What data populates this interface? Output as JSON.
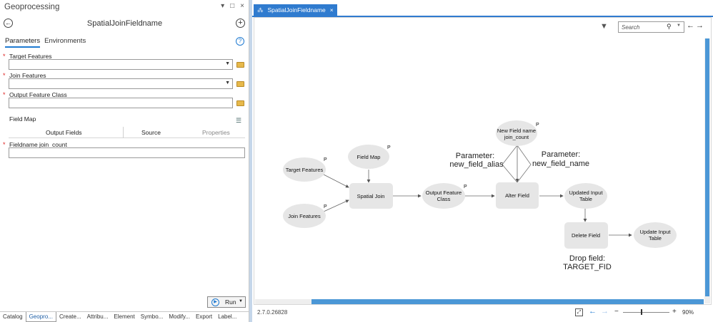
{
  "left_pane": {
    "title": "Geoprocessing",
    "window_controls": [
      "▾",
      "□",
      "×"
    ],
    "tool_title": "SpatialJoinFieldname",
    "tabs": [
      "Parameters",
      "Environments"
    ],
    "params": [
      {
        "label": "Target Features",
        "required": "*"
      },
      {
        "label": "Join Features",
        "required": "*"
      },
      {
        "label": "Output Feature Class",
        "required": "*"
      }
    ],
    "field_map": {
      "label": "Field Map",
      "columns": [
        "Output Fields",
        "Source",
        "Properties"
      ]
    },
    "fieldname_param": {
      "label": "Fieldname join_count",
      "required": "*",
      "value": ""
    },
    "run_label": "Run",
    "bottom_tabs": [
      "Catalog",
      "Geopro...",
      "Create...",
      "Attribu...",
      "Element",
      "Symbo...",
      "Modify...",
      "Export",
      "Label..."
    ]
  },
  "view": {
    "tab_title": "SpatialJoinFieldname",
    "tab_close": "×",
    "search_placeholder": "Search",
    "version": "2.7.0.26828",
    "zoom_level": "90%"
  },
  "model": {
    "nodes": {
      "target_features": "Target Features",
      "join_features": "Join Features",
      "field_map": "Field Map",
      "spatial_join": "Spatial Join",
      "output_fc_1": "Output Feature",
      "output_fc_2": "Class",
      "new_field_1": "New Field name",
      "new_field_2": "join_count",
      "alter_field": "Alter Field",
      "updated_1": "Updated Input",
      "updated_2": "Table",
      "delete_field": "Delete Field",
      "update_1": "Update Input",
      "update_2": "Table"
    },
    "param_marker": "P",
    "annotations": {
      "alias_1": "Parameter:",
      "alias_2": "new_field_alias",
      "name_1": "Parameter:",
      "name_2": "new_field_name",
      "drop_1": "Drop field:",
      "drop_2": "TARGET_FID"
    }
  },
  "colors": {
    "accent": "#2f7bcf",
    "scrollbar": "#4b97d6",
    "node_fill": "#e6e6e6",
    "required": "#dd2222"
  }
}
